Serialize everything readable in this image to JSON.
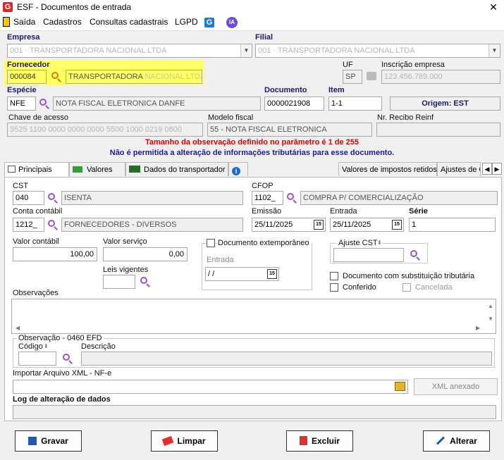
{
  "window": {
    "title": "ESF - Documentos de entrada",
    "close": "✕",
    "logo": "G"
  },
  "menu": {
    "saida": "Saída",
    "cadastros": "Cadastros",
    "consultas": "Consultas cadastrais",
    "lgpd": "LGPD",
    "g_icon": "G",
    "ia_icon": "IA"
  },
  "header": {
    "empresa_label": "Empresa",
    "empresa_value": "001 · TRANSPORTADORA NACIONAL LTDA",
    "filial_label": "Filial",
    "filial_value": "001 · TRANSPORTADORA NACIONAL LTDA",
    "fornecedor_label": "Fornecedor",
    "fornecedor_code": "000084",
    "fornecedor_name": "TRANSPORTADORA",
    "fornecedor_name_blur": "NACIONAL LTDA",
    "uf_label": "UF",
    "uf_value": "SP",
    "inscricao_label": "Inscrição empresa",
    "inscricao_value": "123.456.789.000",
    "especie_label": "Espécie",
    "especie_code": "NFE",
    "especie_desc": "NOTA FISCAL ELETRONICA DANFE",
    "documento_label": "Documento",
    "documento_value": "0000021908",
    "item_label": "Item",
    "item_value": "1-1",
    "origem": "Origem: EST",
    "chave_label": "Chave de acesso",
    "chave_value": "3525 1100 0000 0000 0000 5500 1000 0219 0800",
    "modelo_label": "Modelo fiscal",
    "modelo_value": "55 - NOTA FISCAL ELETRONICA",
    "recibo_label": "Nr. Recibo Reinf",
    "recibo_value": ""
  },
  "messages": {
    "warning_red": "Tamanho da observação definido no parâmetro é 1 de 255",
    "warning_blue": "Não é permitida a alteração de informações tributárias para esse documento."
  },
  "tabs": [
    "Principais",
    "Valores",
    "Dados do transportador",
    "",
    "Valores de impostos retidos",
    "Ajustes de C"
  ],
  "principais": {
    "cst_label": "CST",
    "cst_code": "040",
    "cst_desc": "ISENTA",
    "cfop_label": "CFOP",
    "cfop_code": "1102_",
    "cfop_desc": "COMPRA P/ COMERCIALIZAÇÃO",
    "conta_label": "Conta contábil",
    "conta_code": "1212_",
    "conta_desc": "FORNECEDORES - DIVERSOS",
    "emissao_label": "Emissão",
    "emissao_value": "25/11/2025",
    "entrada_label": "Entrada",
    "entrada_value": "25/11/2025",
    "serie_label": "Série",
    "serie_value": "1",
    "valor_contabil_label": "Valor contábil",
    "valor_contabil_value": "100,00",
    "valor_servico_label": "Valor serviço",
    "valor_servico_value": "0,00",
    "leis_label": "Leis vigentes",
    "leis_value": "",
    "extemporaneo_label": "Documento extemporâneo",
    "entrada2_label": "Entrada",
    "entrada2_value": "/ /",
    "ajuste_cst_label": "Ajuste CST",
    "subst_label": "Documento com substituição tributária",
    "conferido_label": "Conferido",
    "cancelada_label": "Cancelada",
    "obs_label": "Observações",
    "obs_value": "",
    "obs0460_label": "Observação - 0460 EFD",
    "codigo_label": "Código",
    "descricao_label": "Descrição",
    "xml_label": "Importar Arquivo XML - NF-e",
    "xml_button": "XML anexado",
    "log_label": "Log de alteração de dados"
  },
  "buttons": {
    "gravar": "Gravar",
    "limpar": "Limpar",
    "excluir": "Excluir",
    "alterar": "Alterar"
  },
  "colors": {
    "highlight": "#ffff66",
    "error_red": "#e00000",
    "info_blue": "#1a1a9a",
    "label_blue": "#1a1a6a"
  }
}
